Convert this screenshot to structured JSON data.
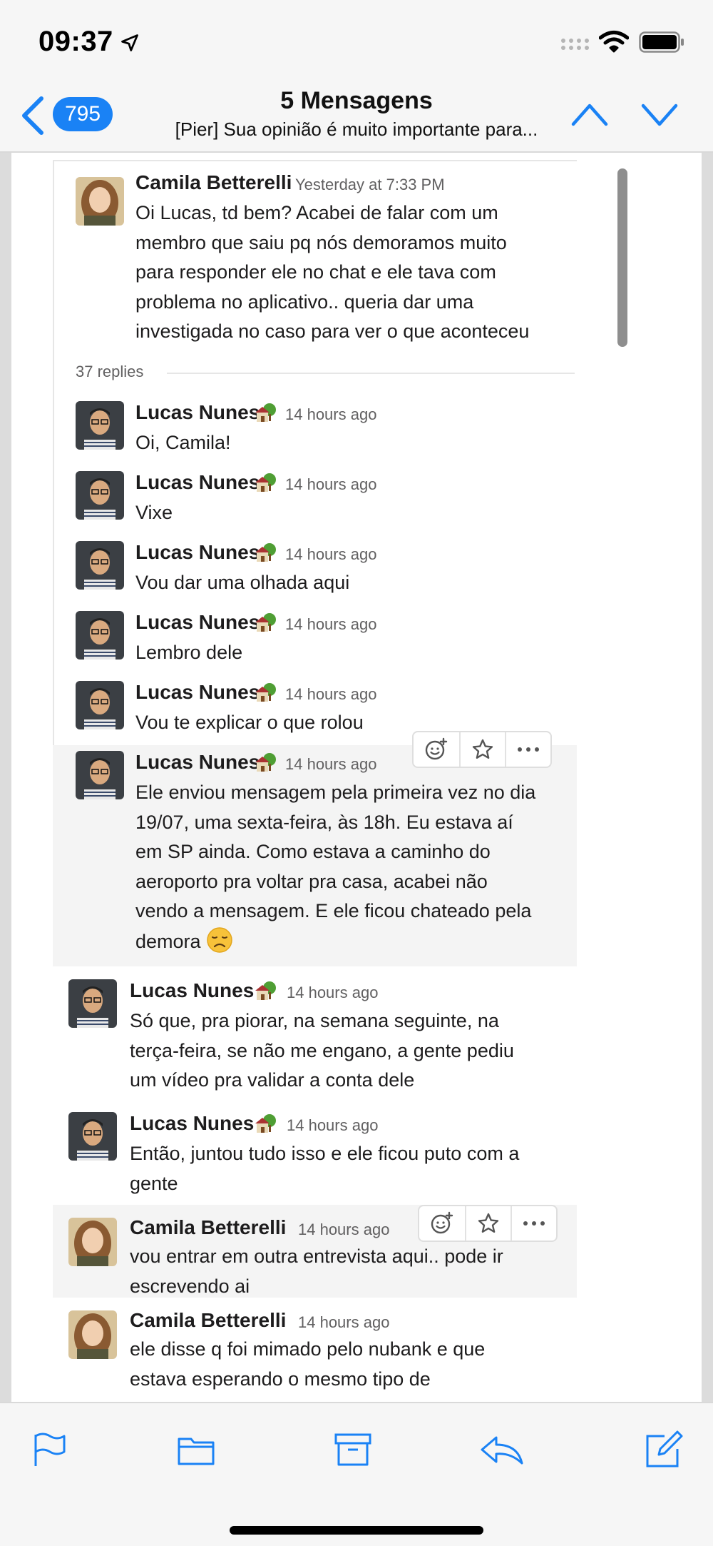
{
  "status_bar": {
    "time": "09:37"
  },
  "header": {
    "badge_count": "795",
    "title": "5 Mensagens",
    "subtitle": "[Pier] Sua opinião é muito importante para..."
  },
  "thread": {
    "parent": {
      "author": "Camila Betterelli",
      "timestamp": "Yesterday at 7:33 PM",
      "lines": [
        "Oi Lucas, td bem? Acabei de falar com um",
        "membro que saiu pq nós demoramos muito",
        "para responder ele no chat e ele tava com",
        "problema no aplicativo.. queria dar uma",
        "investigada no caso para ver o que aconteceu"
      ]
    },
    "replies_label": "37 replies",
    "messages": [
      {
        "author": "Lucas Nunes",
        "timestamp": "14 hours ago",
        "lines": [
          "Oi, Camila!"
        ]
      },
      {
        "author": "Lucas Nunes",
        "timestamp": "14 hours ago",
        "lines": [
          "Vixe"
        ]
      },
      {
        "author": "Lucas Nunes",
        "timestamp": "14 hours ago",
        "lines": [
          "Vou dar uma olhada aqui"
        ]
      },
      {
        "author": "Lucas Nunes",
        "timestamp": "14 hours ago",
        "lines": [
          "Lembro dele"
        ]
      },
      {
        "author": "Lucas Nunes",
        "timestamp": "14 hours ago",
        "lines": [
          "Vou te explicar o que rolou"
        ]
      },
      {
        "author": "Lucas Nunes",
        "timestamp": "14 hours ago",
        "lines": [
          "Ele enviou mensagem pela primeira vez no dia",
          "19/07, uma sexta-feira, às 18h. Eu estava aí",
          "em SP ainda. Como estava a caminho do",
          "aeroporto pra voltar pra casa, acabei não",
          "vendo a mensagem. E ele ficou chateado pela",
          "demora"
        ]
      },
      {
        "author": "Lucas Nunes",
        "timestamp": "14 hours ago",
        "lines": [
          "Só que, pra piorar, na semana seguinte, na",
          "terça-feira, se não me engano, a gente pediu",
          "um vídeo pra validar a conta dele"
        ]
      },
      {
        "author": "Lucas Nunes",
        "timestamp": "14 hours ago",
        "lines": [
          "Então, juntou tudo isso e ele ficou puto com a",
          "gente"
        ]
      },
      {
        "author": "Camila Betterelli",
        "timestamp": "14 hours ago",
        "lines": [
          "vou entrar em outra entrevista aqui.. pode ir",
          "escrevendo ai"
        ]
      },
      {
        "author": "Camila Betterelli",
        "timestamp": "14 hours ago",
        "lines": [
          "ele disse q foi mimado pelo nubank e que",
          "estava esperando o mesmo tipo de"
        ]
      }
    ]
  },
  "icons": {
    "reaction": "add-reaction-icon",
    "star": "star-icon",
    "more": "more-icon",
    "status_emoji": "house-with-garden-icon",
    "sad": "disappointed-face-icon"
  },
  "colors": {
    "accent": "#1a82f5",
    "text": "#1d1c1d",
    "muted": "#616061"
  }
}
